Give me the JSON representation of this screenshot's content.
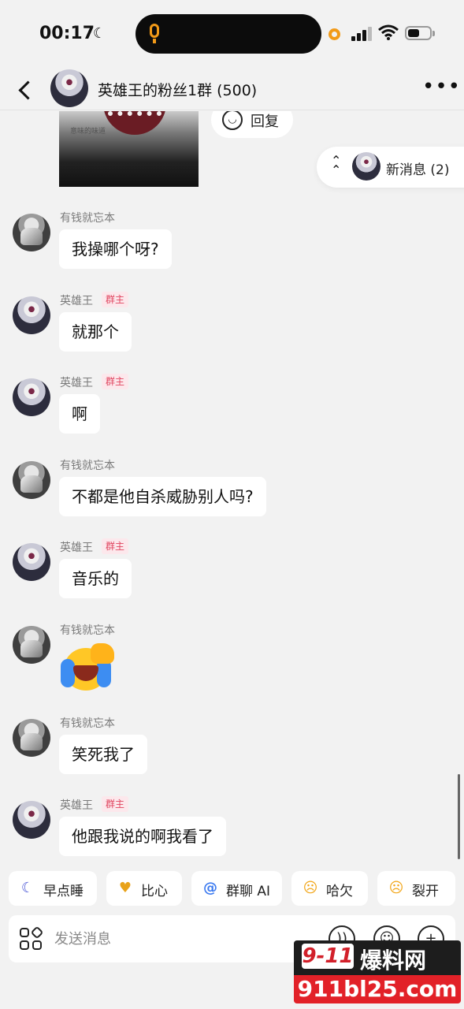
{
  "status_bar": {
    "time": "00:17"
  },
  "header": {
    "title": "英雄王的粉丝1群 (500)",
    "more": "•••"
  },
  "reply_chip": {
    "label": "回复"
  },
  "photo": {
    "caption": "意味的味道"
  },
  "new_messages": {
    "label": "新消息 (2)"
  },
  "messages": [
    {
      "sender": "有钱就忘本",
      "text": "我操哪个呀?"
    },
    {
      "sender": "英雄王",
      "badge": "群主",
      "text": "就那个"
    },
    {
      "sender": "英雄王",
      "badge": "群主",
      "text": "啊"
    },
    {
      "sender": "有钱就忘本",
      "text": "不都是他自杀威胁别人吗?"
    },
    {
      "sender": "英雄王",
      "badge": "群主",
      "text": "音乐的"
    },
    {
      "sender": "有钱就忘本",
      "text": ""
    },
    {
      "sender": "有钱就忘本",
      "text": "笑死我了"
    },
    {
      "sender": "英雄王",
      "badge": "群主",
      "text": "他跟我说的啊我看了"
    }
  ],
  "quick_replies": [
    {
      "icon": "sleep-moon-icon",
      "label": "早点睡"
    },
    {
      "icon": "heart-hands-icon",
      "label": "比心"
    },
    {
      "icon": "at-icon",
      "label": "群聊 AI"
    },
    {
      "icon": "yawn-face-icon",
      "label": "哈欠"
    },
    {
      "icon": "crying-face-icon",
      "label": "裂开"
    }
  ],
  "input": {
    "placeholder": "发送消息"
  },
  "watermark": {
    "top": "9-11 爆料网",
    "bottom": "911bl25.com"
  }
}
